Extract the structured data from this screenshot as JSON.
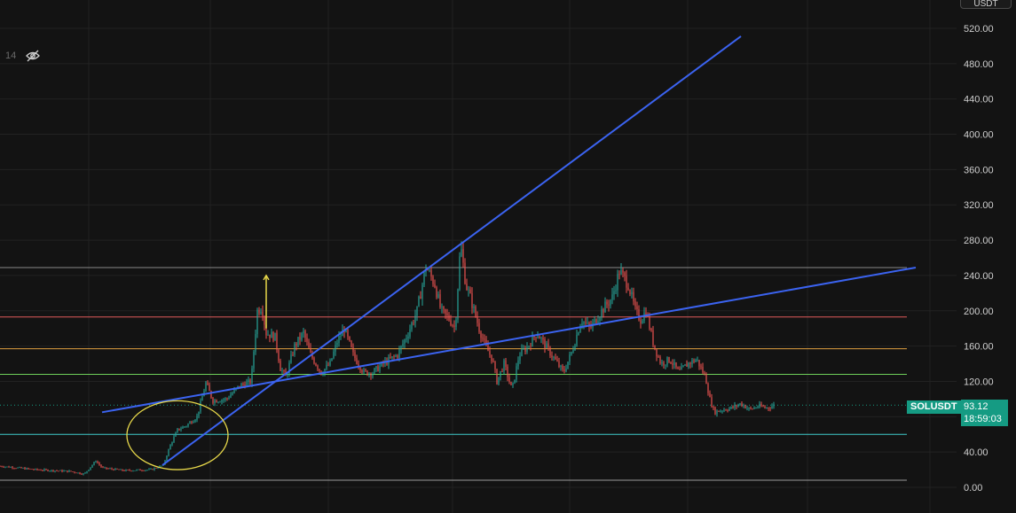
{
  "header": {
    "indicator_value": "14",
    "currency_label": "USDT"
  },
  "symbol": {
    "name": "SOLUSDT",
    "last_price": "93.12",
    "countdown": "18:59:03"
  },
  "colors": {
    "background": "#131313",
    "grid": "#222222",
    "up_candle": "#26a69a",
    "down_candle": "#ef5350",
    "trendline": "#3b63f0",
    "ellipse": "#e7d84a",
    "arrow": "#e7d84a",
    "price_tag": "#159b83"
  },
  "chart_data": {
    "type": "candlestick",
    "title": "",
    "xlabel": "",
    "ylabel": "",
    "ylim": [
      -5,
      535
    ],
    "y_ticks": [
      "0.00",
      "40.00",
      "80.00",
      "120.00",
      "160.00",
      "200.00",
      "240.00",
      "280.00",
      "320.00",
      "360.00",
      "400.00",
      "440.00",
      "480.00",
      "520.00"
    ],
    "price_path": [
      [
        0,
        24
      ],
      [
        40,
        20
      ],
      [
        80,
        18
      ],
      [
        95,
        15
      ],
      [
        108,
        30
      ],
      [
        115,
        22
      ],
      [
        140,
        19
      ],
      [
        170,
        20
      ],
      [
        184,
        25
      ],
      [
        192,
        48
      ],
      [
        200,
        65
      ],
      [
        210,
        70
      ],
      [
        222,
        80
      ],
      [
        232,
        118
      ],
      [
        240,
        98
      ],
      [
        255,
        100
      ],
      [
        270,
        115
      ],
      [
        283,
        120
      ],
      [
        290,
        200
      ],
      [
        295,
        205
      ],
      [
        300,
        175
      ],
      [
        310,
        170
      ],
      [
        316,
        135
      ],
      [
        322,
        125
      ],
      [
        332,
        160
      ],
      [
        342,
        175
      ],
      [
        350,
        150
      ],
      [
        362,
        130
      ],
      [
        372,
        140
      ],
      [
        380,
        165
      ],
      [
        388,
        180
      ],
      [
        398,
        150
      ],
      [
        410,
        130
      ],
      [
        420,
        130
      ],
      [
        432,
        140
      ],
      [
        448,
        150
      ],
      [
        460,
        175
      ],
      [
        470,
        200
      ],
      [
        480,
        250
      ],
      [
        490,
        230
      ],
      [
        497,
        200
      ],
      [
        507,
        190
      ],
      [
        513,
        180
      ],
      [
        519,
        275
      ],
      [
        525,
        230
      ],
      [
        530,
        215
      ],
      [
        540,
        180
      ],
      [
        547,
        160
      ],
      [
        555,
        145
      ],
      [
        560,
        120
      ],
      [
        568,
        140
      ],
      [
        577,
        110
      ],
      [
        585,
        150
      ],
      [
        595,
        160
      ],
      [
        605,
        175
      ],
      [
        615,
        160
      ],
      [
        625,
        145
      ],
      [
        635,
        130
      ],
      [
        645,
        155
      ],
      [
        655,
        190
      ],
      [
        665,
        180
      ],
      [
        678,
        200
      ],
      [
        690,
        215
      ],
      [
        698,
        245
      ],
      [
        708,
        230
      ],
      [
        716,
        200
      ],
      [
        722,
        190
      ],
      [
        728,
        200
      ],
      [
        737,
        160
      ],
      [
        745,
        140
      ],
      [
        755,
        145
      ],
      [
        765,
        130
      ],
      [
        775,
        140
      ],
      [
        785,
        145
      ],
      [
        795,
        125
      ],
      [
        800,
        100
      ],
      [
        805,
        85
      ],
      [
        815,
        88
      ],
      [
        825,
        90
      ],
      [
        835,
        95
      ],
      [
        845,
        88
      ],
      [
        855,
        92
      ],
      [
        865,
        90
      ],
      [
        872,
        93
      ]
    ],
    "horizontal_levels": [
      {
        "value": 249,
        "color": "#8a8a8a"
      },
      {
        "value": 193,
        "color": "#e05a5a"
      },
      {
        "value": 157,
        "color": "#e0a040"
      },
      {
        "value": 128,
        "color": "#6fcf5a"
      },
      {
        "value": 60,
        "color": "#3fc9c9"
      },
      {
        "value": 8,
        "color": "#9a9a9a"
      }
    ],
    "last_price_value": 93.12,
    "trendlines": [
      {
        "x1": 183,
        "y1": 25,
        "x2": 835,
        "y2": 511
      },
      {
        "x1": 115,
        "y1": 85,
        "x2": 1032,
        "y2": 249
      }
    ],
    "ellipse": {
      "cx": 200,
      "cy": 59,
      "rx": 57,
      "ry": 39
    },
    "arrow": {
      "x": 300,
      "from": 180,
      "to": 240
    }
  }
}
